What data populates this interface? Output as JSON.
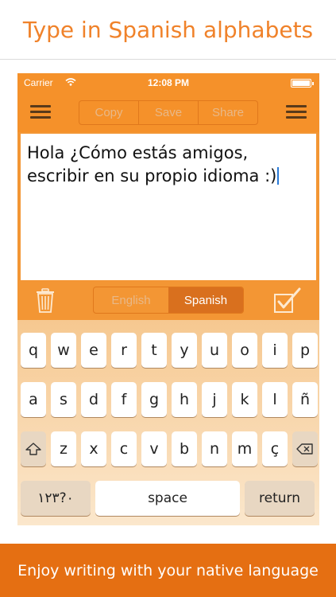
{
  "headline": "Type in Spanish alphabets",
  "footer": "Enjoy writing with your native language",
  "status": {
    "carrier": "Carrier",
    "time": "12:08 PM"
  },
  "toolbar": {
    "copy": "Copy",
    "save": "Save",
    "share": "Share"
  },
  "editor": {
    "text": "Hola ¿Cómo estás amigos, escribir en su propio idioma :)"
  },
  "languages": {
    "english": "English",
    "spanish": "Spanish",
    "selected": "Spanish"
  },
  "keyboard": {
    "row1": [
      "q",
      "w",
      "e",
      "r",
      "t",
      "y",
      "u",
      "o",
      "i",
      "p"
    ],
    "row2": [
      "a",
      "s",
      "d",
      "f",
      "g",
      "h",
      "j",
      "k",
      "l",
      "ñ"
    ],
    "row3": [
      "z",
      "x",
      "c",
      "v",
      "b",
      "n",
      "m",
      "ç"
    ],
    "numbers": "٠?١٢٣",
    "space": "space",
    "return": "return"
  },
  "colors": {
    "accent": "#f0822a",
    "bar": "#f5912a",
    "footer": "#e56f12"
  }
}
